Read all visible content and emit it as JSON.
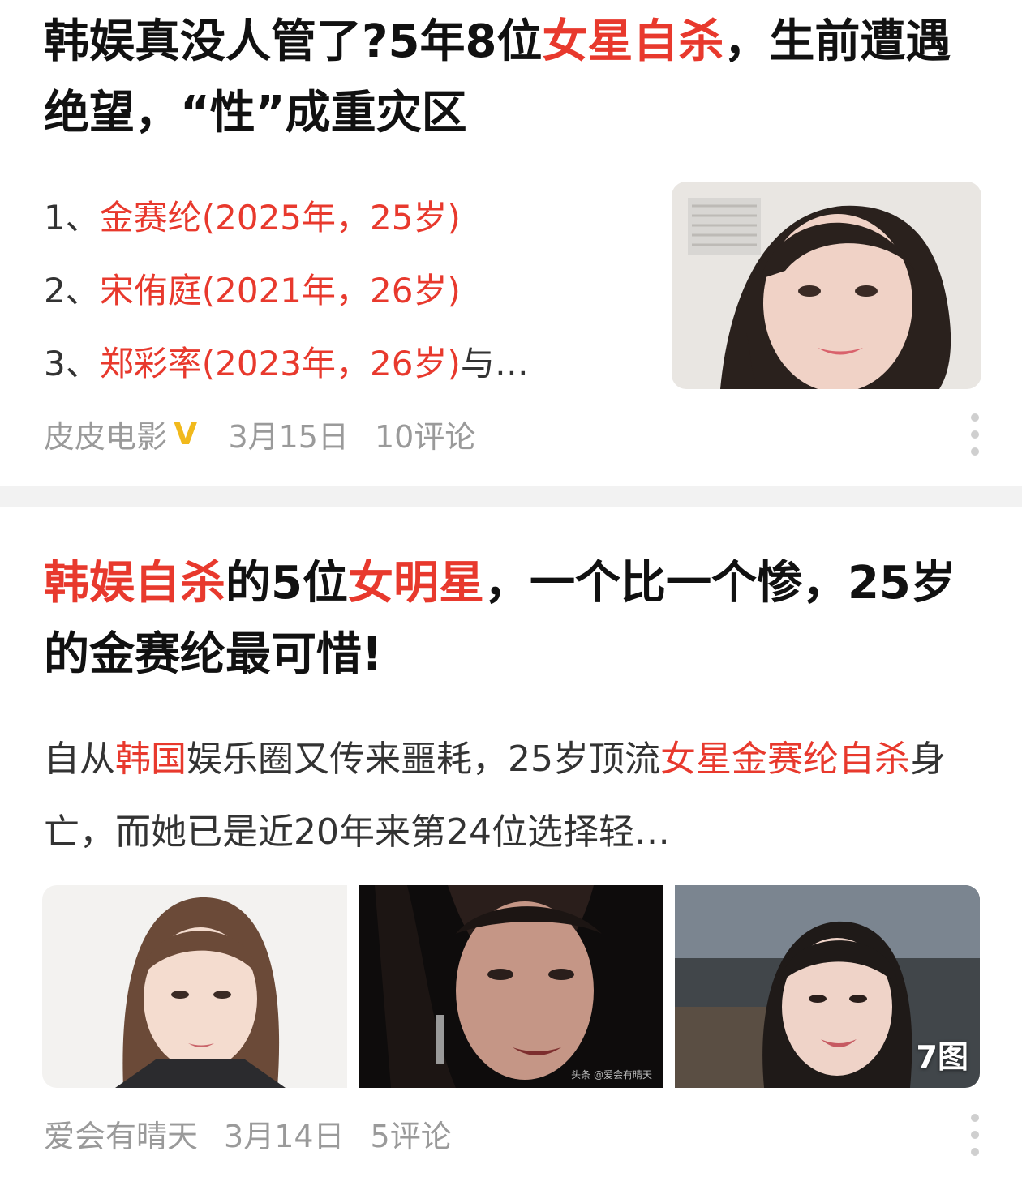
{
  "articles": [
    {
      "title_parts": [
        "韩娱真没人管了?5年8位",
        "女星自杀",
        "，生前遭遇绝望，“性”成重灾区"
      ],
      "list": [
        {
          "num": "1、",
          "name": "金赛纶",
          "detail": "(2025年，25岁)",
          "suffix": ""
        },
        {
          "num": "2、",
          "name": "宋侑庭",
          "detail": "(2021年，26岁)",
          "suffix": ""
        },
        {
          "num": "3、",
          "name": "郑彩率",
          "detail": "(2023年，26岁)",
          "suffix": "与…"
        }
      ],
      "author": "皮皮电影",
      "verified_icon": "V",
      "date": "3月15日",
      "comments": "10评论"
    },
    {
      "title_parts": [
        "韩娱自杀",
        "的5位",
        "女明星",
        "，一个比一个惨，25岁的金赛纶最可惜!"
      ],
      "summary_parts": [
        "自从",
        "韩国",
        "娱乐圈又传来噩耗，25岁顶流",
        "女星金赛纶自杀",
        "身亡，而她已是近20年来第24位选择轻…"
      ],
      "image_count": "7图",
      "watermark": "头条 @爱会有晴天",
      "author": "爱会有晴天",
      "date": "3月14日",
      "comments": "5评论"
    }
  ],
  "colors": {
    "highlight": "#e8392d",
    "meta_text": "#9a9a9a",
    "verified": "#f1b91c",
    "divider": "#f2f2f2"
  },
  "icons": [
    "verified-v-icon",
    "more-dots-icon"
  ]
}
